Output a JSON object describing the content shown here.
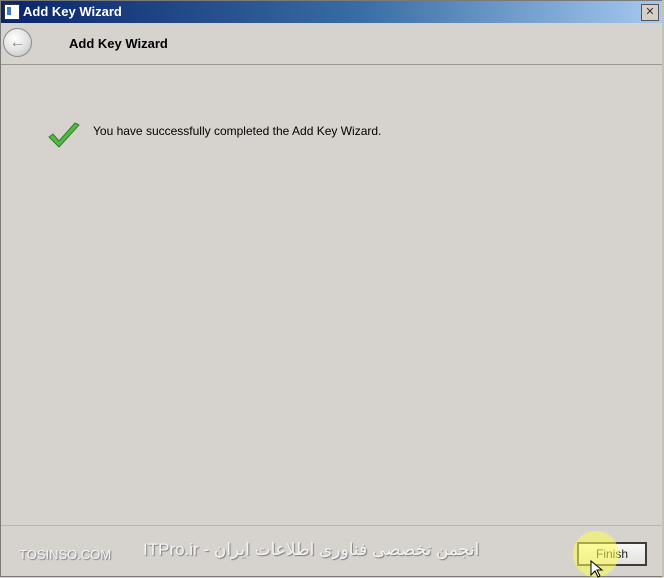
{
  "window": {
    "title": "Add Key Wizard",
    "close_glyph": "✕"
  },
  "header": {
    "title": "Add Key Wizard",
    "back_glyph": "←"
  },
  "content": {
    "message": "You have successfully completed the Add Key Wizard.",
    "status_icon": "checkmark-icon",
    "status_color": "#4cae3c"
  },
  "footer": {
    "finish_label": "Finish"
  },
  "watermarks": {
    "left": "TOSINSO.COM",
    "center": "ITPro.ir - انجمن تخصصی فناوری اطلاعات ایران"
  }
}
